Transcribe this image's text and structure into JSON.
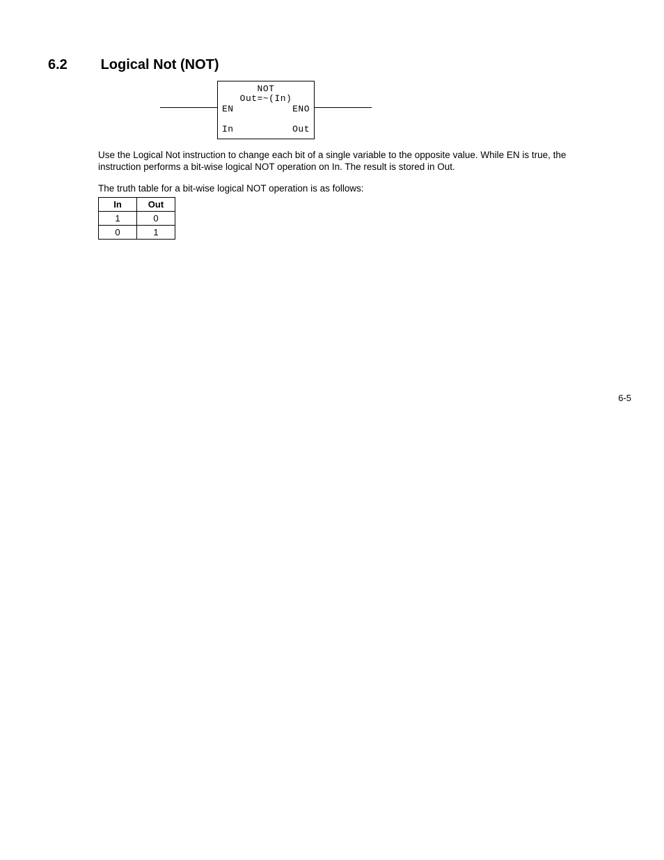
{
  "heading": {
    "number": "6.2",
    "title": "Logical Not (NOT)"
  },
  "diagram": {
    "title1": "NOT",
    "title2": "Out=~(In)",
    "en": "EN",
    "eno": "ENO",
    "in": "In",
    "out": "Out"
  },
  "paragraphs": {
    "p1": "Use the Logical Not instruction to change each bit of a single variable to the opposite value. While EN is true, the instruction performs a bit-wise logical NOT operation on In. The result is stored in Out.",
    "p2": "The truth table for a bit-wise logical NOT operation is as follows:"
  },
  "truth_table": {
    "headers": [
      "In",
      "Out"
    ],
    "rows": [
      [
        "1",
        "0"
      ],
      [
        "0",
        "1"
      ]
    ]
  },
  "page_number": "6-5"
}
